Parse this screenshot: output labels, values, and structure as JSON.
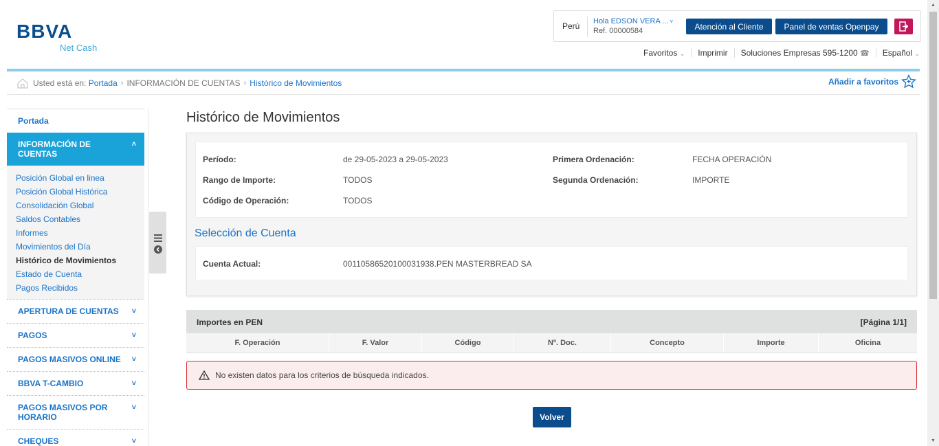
{
  "logo": {
    "main": "BBVA",
    "sub": "Net Cash"
  },
  "userbox": {
    "country": "Perú",
    "greeting": "Hola EDSON VERA ...",
    "reference": "Ref. 00000584",
    "customer_service_label": "Atención al Cliente",
    "openpay_label": "Panel de ventas Openpay"
  },
  "top_links": {
    "favoritos": "Favoritos",
    "imprimir": "Imprimir",
    "soluciones": "Soluciones Empresas 595-1200",
    "idioma": "Español"
  },
  "breadcrumb": {
    "prefix": "Usted está en:",
    "items": [
      "Portada",
      "INFORMACIÓN DE CUENTAS",
      "Histórico de Movimientos"
    ],
    "add_favorites": "Añadir a favoritos"
  },
  "sidebar": {
    "portada": "Portada",
    "active_section": "INFORMACIÓN DE CUENTAS",
    "sub_items": [
      "Posición Global en linea",
      "Posición Global Histórica",
      "Consolidación Global",
      "Saldos Contables",
      "Informes",
      "Movimientos del Día",
      "Histórico de Movimientos",
      "Estado de Cuenta",
      "Pagos Recibidos"
    ],
    "current_index": 6,
    "sections": [
      "APERTURA DE CUENTAS",
      "PAGOS",
      "PAGOS MASIVOS ONLINE",
      "BBVA T-CAMBIO",
      "PAGOS MASIVOS POR HORARIO",
      "CHEQUES"
    ]
  },
  "main": {
    "title": "Histórico de Movimientos",
    "filters": {
      "periodo_label": "Período:",
      "periodo_value": "de 29-05-2023 a 29-05-2023",
      "rango_label": "Rango de Importe:",
      "rango_value": "TODOS",
      "codigo_label": "Código de Operación:",
      "codigo_value": "TODOS",
      "primera_label": "Primera Ordenación:",
      "primera_value": "FECHA OPERACIÓN",
      "segunda_label": "Segunda Ordenación:",
      "segunda_value": "IMPORTE"
    },
    "account_section_title": "Selección de Cuenta",
    "cuenta_label": "Cuenta Actual:",
    "cuenta_value": "00110586520100031938.PEN MASTERBREAD SA",
    "table": {
      "title": "Importes en PEN",
      "page": "[Página 1/1]",
      "columns": [
        "F. Operación",
        "F. Valor",
        "Código",
        "Nº. Doc.",
        "Concepto",
        "Importe",
        "Oficina"
      ]
    },
    "empty_message": "No existen datos para los criterios de búsqueda indicados.",
    "back_button": "Volver"
  },
  "colors": {
    "brand": "#0b4c8c",
    "accent": "#1aa3d8",
    "link": "#1a73c8",
    "alert_border": "#d32f2f",
    "exit": "#c2185b"
  }
}
